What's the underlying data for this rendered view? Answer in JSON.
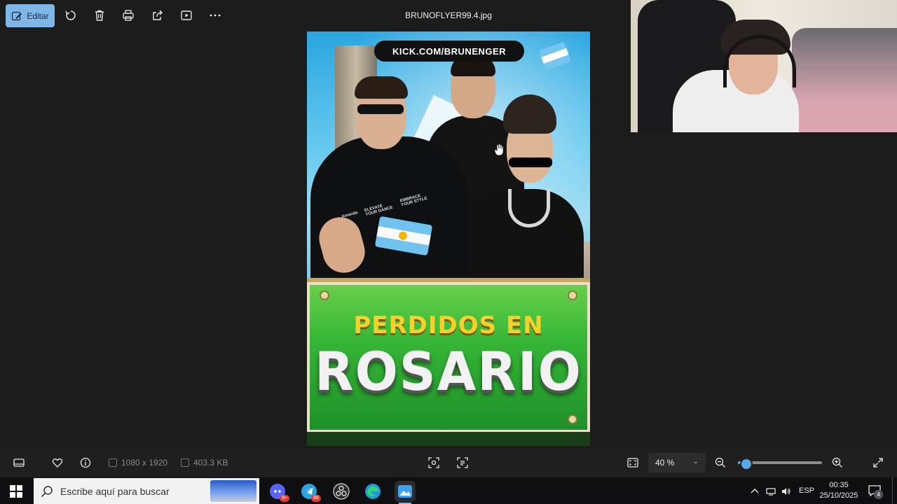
{
  "toolbar": {
    "edit_label": "Editar",
    "file_title": "BRUNOFLYER99.4.jpg"
  },
  "poster": {
    "kick_text": "KICK.COM/BRUNENGER",
    "banner_line1": "PERDIDOS EN",
    "banner_line2": "ROSARIO",
    "hoodie_words": [
      "Amanda",
      "ELEVATE YOUR DANCE",
      "EMBRACE YOUR STYLE"
    ]
  },
  "bottombar": {
    "dimensions": "1080 x 1920",
    "file_size": "403.3 KB",
    "zoom_value": "40 %",
    "zoom_fraction": 0.1
  },
  "taskbar": {
    "search_placeholder": "Escribe aquí para buscar",
    "apps": [
      {
        "icon": "discord-icon",
        "badge": "9+"
      },
      {
        "icon": "telegram-icon",
        "badge": "66"
      },
      {
        "icon": "obs-icon",
        "badge": ""
      },
      {
        "icon": "edge-icon",
        "badge": ""
      },
      {
        "icon": "photos-icon",
        "badge": ""
      }
    ],
    "language": "ESP",
    "time": "00:35",
    "date": "25/10/2025",
    "notification_count": "4"
  },
  "colors": {
    "accent": "#7fb6e8",
    "background": "#1c1c1c",
    "banner_green": "#35b535",
    "banner_yellow": "#f4d22a"
  }
}
